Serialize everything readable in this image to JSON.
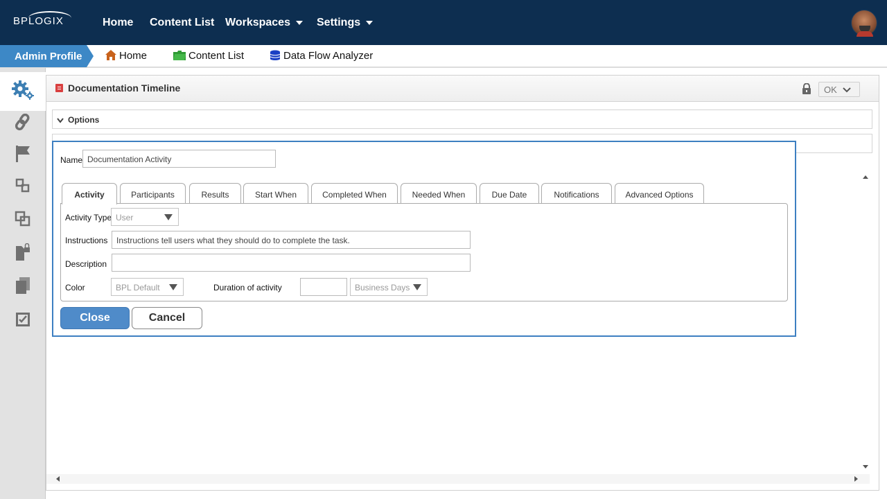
{
  "brand": {
    "logo_text": "BPLOGIX"
  },
  "topnav": {
    "items": [
      {
        "label": "Home"
      },
      {
        "label": "Content List"
      },
      {
        "label": "Workspaces"
      },
      {
        "label": "Settings"
      }
    ]
  },
  "breadcrumb": {
    "profile": "Admin Profile",
    "items": [
      {
        "label": "Home",
        "icon": "house-icon"
      },
      {
        "label": "Content List",
        "icon": "folder-icon"
      },
      {
        "label": "Data Flow Analyzer",
        "icon": "database-icon"
      }
    ]
  },
  "sidebar": {
    "items": [
      {
        "icon": "gears-icon",
        "active": true
      },
      {
        "icon": "link-icon"
      },
      {
        "icon": "flag-icon"
      },
      {
        "icon": "workflow-icon"
      },
      {
        "icon": "copy-icon"
      },
      {
        "icon": "locked-document-icon"
      },
      {
        "icon": "documents-icon"
      },
      {
        "icon": "checked-list-icon"
      }
    ]
  },
  "panel": {
    "title": "Documentation Timeline",
    "ok_label": "OK",
    "options_label": "Options"
  },
  "dialog": {
    "name_label": "Name",
    "name_value": "Documentation Activity",
    "tabs": [
      {
        "label": "Activity",
        "active": true
      },
      {
        "label": "Participants"
      },
      {
        "label": "Results"
      },
      {
        "label": "Start When"
      },
      {
        "label": "Completed When"
      },
      {
        "label": "Needed When"
      },
      {
        "label": "Due Date"
      },
      {
        "label": "Notifications"
      },
      {
        "label": "Advanced Options"
      }
    ],
    "activity_type_label": "Activity Type",
    "activity_type_value": "User",
    "instructions_label": "Instructions",
    "instructions_value": "Instructions tell users what they should do to complete the task.",
    "description_label": "Description",
    "description_value": "",
    "color_label": "Color",
    "color_value": "BPL Default",
    "duration_label": "Duration of activity",
    "duration_value": "",
    "duration_unit": "Business Days",
    "close_label": "Close",
    "cancel_label": "Cancel"
  },
  "colors": {
    "topnav_bg": "#0d2e50",
    "accent": "#3d88c6",
    "close_button": "#4f8bc9",
    "dialog_border": "#3d7fc1"
  }
}
